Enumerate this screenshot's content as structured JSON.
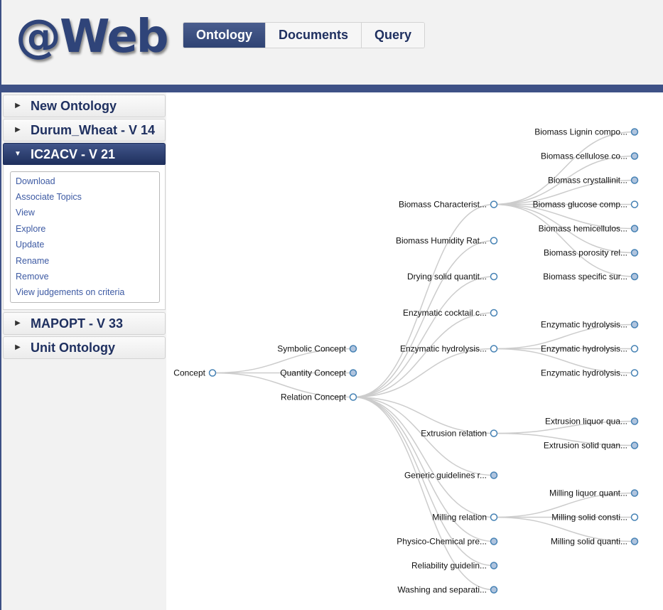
{
  "app": {
    "logo": "@Web",
    "tabs": [
      {
        "label": "Ontology",
        "active": true
      },
      {
        "label": "Documents",
        "active": false
      },
      {
        "label": "Query",
        "active": false
      }
    ],
    "accent_color": "#3e5186"
  },
  "sidebar": {
    "headers": [
      {
        "label": "New Ontology",
        "expanded": false
      },
      {
        "label": "Durum_Wheat - V 14",
        "expanded": false
      },
      {
        "label": "IC2ACV - V 21",
        "expanded": true
      },
      {
        "label": "MAPOPT - V 33",
        "expanded": false
      },
      {
        "label": "Unit Ontology",
        "expanded": false
      }
    ],
    "menu": [
      "Download",
      "Associate Topics",
      "View",
      "Explore",
      "Update",
      "Rename",
      "Remove",
      "View judgements on criteria"
    ]
  },
  "tree": {
    "root": {
      "label": "Concept",
      "has_children": true
    },
    "level1": [
      {
        "label": "Symbolic Concept",
        "has_children": false
      },
      {
        "label": "Quantity Concept",
        "has_children": false
      },
      {
        "label": "Relation Concept",
        "has_children": true
      }
    ],
    "level2": [
      {
        "label": "Biomass Characterist...",
        "has_children": true
      },
      {
        "label": "Biomass Humidity Rat...",
        "has_children": true
      },
      {
        "label": "Drying solid quantit...",
        "has_children": true
      },
      {
        "label": "Enzymatic cocktail c...",
        "has_children": true
      },
      {
        "label": "Enzymatic hydrolysis...",
        "has_children": true
      },
      {
        "label": "Extrusion relation",
        "has_children": true
      },
      {
        "label": "Generic guidelines r...",
        "has_children": false
      },
      {
        "label": "Milling relation",
        "has_children": true
      },
      {
        "label": "Physico-Chemical pre...",
        "has_children": false
      },
      {
        "label": "Reliability guidelin...",
        "has_children": false
      },
      {
        "label": "Washing and separati...",
        "has_children": false
      }
    ],
    "level3": [
      {
        "label": "Biomass Lignin compo...",
        "parent": 0,
        "has_children": false
      },
      {
        "label": "Biomass cellulose co...",
        "parent": 0,
        "has_children": false
      },
      {
        "label": "Biomass crystallinit...",
        "parent": 0,
        "has_children": false
      },
      {
        "label": "Biomass glucose comp...",
        "parent": 0,
        "has_children": true
      },
      {
        "label": "Biomass hemicellulos...",
        "parent": 0,
        "has_children": false
      },
      {
        "label": "Biomass porosity rel...",
        "parent": 0,
        "has_children": false
      },
      {
        "label": "Biomass specific sur...",
        "parent": 0,
        "has_children": false
      },
      {
        "label": "Enzymatic hydrolysis...",
        "parent": 4,
        "has_children": false
      },
      {
        "label": "Enzymatic hydrolysis...",
        "parent": 4,
        "has_children": true
      },
      {
        "label": "Enzymatic hydrolysis...",
        "parent": 4,
        "has_children": true
      },
      {
        "label": "Extrusion liquor qua...",
        "parent": 5,
        "has_children": false
      },
      {
        "label": "Extrusion solid quan...",
        "parent": 5,
        "has_children": false
      },
      {
        "label": "Milling liquor quant...",
        "parent": 7,
        "has_children": false
      },
      {
        "label": "Milling solid consti...",
        "parent": 7,
        "has_children": true
      },
      {
        "label": "Milling solid quanti...",
        "parent": 7,
        "has_children": false
      }
    ],
    "colors": {
      "link": "#cccccc",
      "node_stroke": "#4682b4",
      "node_leaf_fill": "#b0c4de",
      "node_open_fill": "#ffffff"
    }
  }
}
